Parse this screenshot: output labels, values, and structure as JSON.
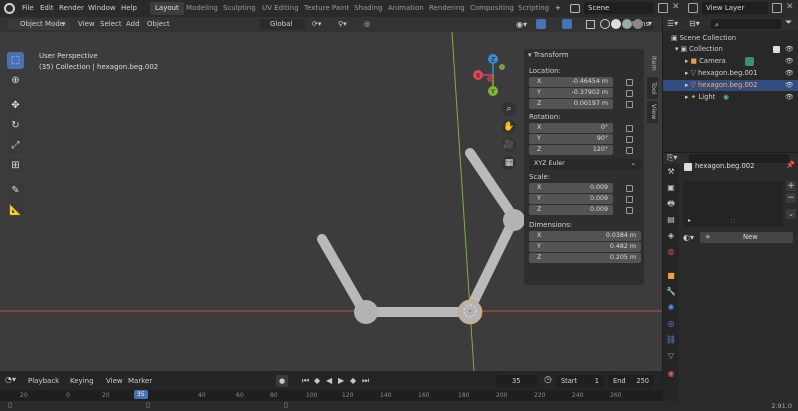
{
  "app_menu": [
    "File",
    "Edit",
    "Render",
    "Window",
    "Help"
  ],
  "workspaces": [
    "Layout",
    "Modeling",
    "Sculpting",
    "UV Editing",
    "Texture Paint",
    "Shading",
    "Animation",
    "Rendering",
    "Compositing",
    "Scripting"
  ],
  "add_workspace": "+",
  "scene_field": "Scene",
  "view_layer_field": "View Layer",
  "viewport": {
    "mode": "Object Mode",
    "menus": [
      "View",
      "Select",
      "Add",
      "Object"
    ],
    "orientation": "Global",
    "options_label": "Options",
    "info_line1": "User Perspective",
    "info_line2": "(35) Collection | hexagon.beg.002",
    "gizmo_axes": {
      "x": "X",
      "y": "Y",
      "z": "Z"
    },
    "colors": {
      "background": "#3c3c3c",
      "x_axis": "#c64a55",
      "y_axis": "#7fb33a",
      "selection_outline": "#f0a040"
    }
  },
  "npanel": {
    "title": "Transform",
    "tabs": [
      "Item",
      "Tool",
      "View"
    ],
    "location_label": "Location:",
    "location": [
      {
        "axis": "X",
        "value": "-0.46454 m"
      },
      {
        "axis": "Y",
        "value": "-0.37902 m"
      },
      {
        "axis": "Z",
        "value": "0.00197 m"
      }
    ],
    "rotation_label": "Rotation:",
    "rotation": [
      {
        "axis": "X",
        "value": "0°"
      },
      {
        "axis": "Y",
        "value": "90°"
      },
      {
        "axis": "Z",
        "value": "120°"
      }
    ],
    "rotation_mode": "XYZ Euler",
    "scale_label": "Scale:",
    "scale": [
      {
        "axis": "X",
        "value": "0.009"
      },
      {
        "axis": "Y",
        "value": "0.009"
      },
      {
        "axis": "Z",
        "value": "0.009"
      }
    ],
    "dimensions_label": "Dimensions:",
    "dimensions": [
      {
        "axis": "X",
        "value": "0.0384 m"
      },
      {
        "axis": "Y",
        "value": "0.482 m"
      },
      {
        "axis": "Z",
        "value": "0.205 m"
      }
    ]
  },
  "outliner": {
    "root": "Scene Collection",
    "collection": "Collection",
    "items": [
      {
        "label": "Camera",
        "selected": false
      },
      {
        "label": "hexagon.beg.001",
        "selected": false
      },
      {
        "label": "hexagon.beg.002",
        "selected": true
      },
      {
        "label": "Light",
        "selected": false
      }
    ]
  },
  "properties": {
    "object_name": "hexagon.beg.002",
    "new_label": "New"
  },
  "timeline": {
    "menus": [
      "Playback",
      "Keying",
      "View",
      "Marker"
    ],
    "current_frame": "35",
    "start_label": "Start",
    "start_value": "1",
    "end_label": "End",
    "end_value": "250",
    "ruler_ticks": [
      "20",
      "0",
      "20",
      "40",
      "60",
      "80",
      "100",
      "120",
      "140",
      "160",
      "180",
      "200",
      "220",
      "240",
      "260"
    ],
    "ruler_current": "35"
  },
  "status": {
    "version": "2.91.0"
  }
}
